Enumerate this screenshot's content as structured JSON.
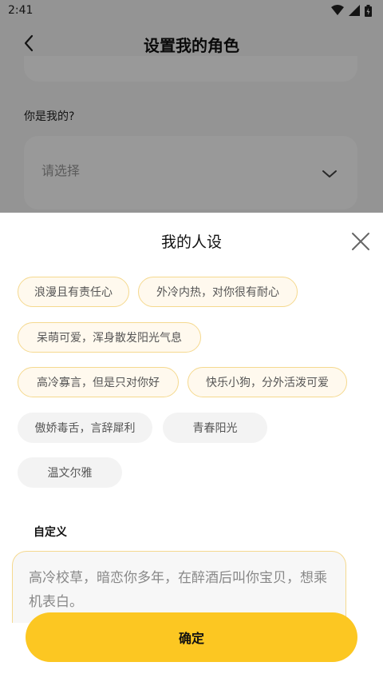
{
  "status_bar": {
    "time": "2:41"
  },
  "header": {
    "title": "设置我的角色",
    "back_icon": "chevron-left-icon"
  },
  "background_form": {
    "question_label": "你是我的?",
    "select_placeholder": "请选择"
  },
  "sheet": {
    "title": "我的人设",
    "tags": [
      {
        "label": "浪漫且有责任心",
        "selected": true
      },
      {
        "label": "外冷内热，对你很有耐心",
        "selected": true
      },
      {
        "label": "呆萌可爱，浑身散发阳光气息",
        "selected": true
      },
      {
        "label": "高冷寡言，但是只对你好",
        "selected": true
      },
      {
        "label": "快乐小狗，分外活泼可爱",
        "selected": true
      },
      {
        "label": "傲娇毒舌，言辞犀利",
        "selected": false
      },
      {
        "label": "青春阳光",
        "selected": false
      },
      {
        "label": "温文尔雅",
        "selected": false
      }
    ],
    "custom_label": "自定义",
    "custom_text": "高冷校草，暗恋你多年，在醉酒后叫你宝贝，想乘机表白。",
    "confirm_label": "确定"
  },
  "colors": {
    "accent": "#fcc722",
    "tag_border": "#f5d98f",
    "tag_bg": "#f3f3f3"
  }
}
